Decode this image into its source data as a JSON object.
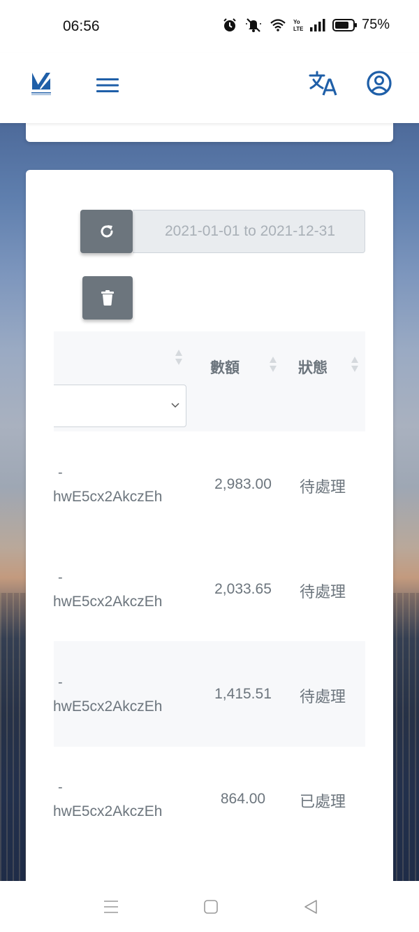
{
  "status_bar": {
    "time": "06:56",
    "battery": "75%",
    "icons": [
      "alarm-icon",
      "mute-icon",
      "wifi-icon",
      "volte-icon",
      "signal-icon",
      "battery-icon"
    ]
  },
  "header": {
    "icons": [
      "logo",
      "menu-icon",
      "translate-icon",
      "account-icon"
    ],
    "accent": "#1f5fa8"
  },
  "toolbar": {
    "date_range_placeholder": "2021-01-01 to 2021-12-31",
    "refresh_icon": "refresh-icon",
    "delete_icon": "trash-icon"
  },
  "table": {
    "columns": [
      "數額",
      "狀態"
    ],
    "rows": [
      {
        "id_prefix": "-",
        "id": "hwE5cx2AkczEh",
        "amount": "2,983.00",
        "status": "待處理"
      },
      {
        "id_prefix": "-",
        "id": "hwE5cx2AkczEh",
        "amount": "2,033.65",
        "status": "待處理"
      },
      {
        "id_prefix": "-",
        "id": "hwE5cx2AkczEh",
        "amount": "1,415.51",
        "status": "待處理"
      },
      {
        "id_prefix": "-",
        "id": "hwE5cx2AkczEh",
        "amount": "864.00",
        "status": "已處理"
      }
    ]
  },
  "nav_bar": {
    "icons": [
      "recent-apps-icon",
      "home-icon",
      "back-icon"
    ]
  },
  "colors": {
    "button_gray": "#6c757d",
    "text_muted": "#6c757d",
    "header_bg": "#f7f8fa"
  }
}
